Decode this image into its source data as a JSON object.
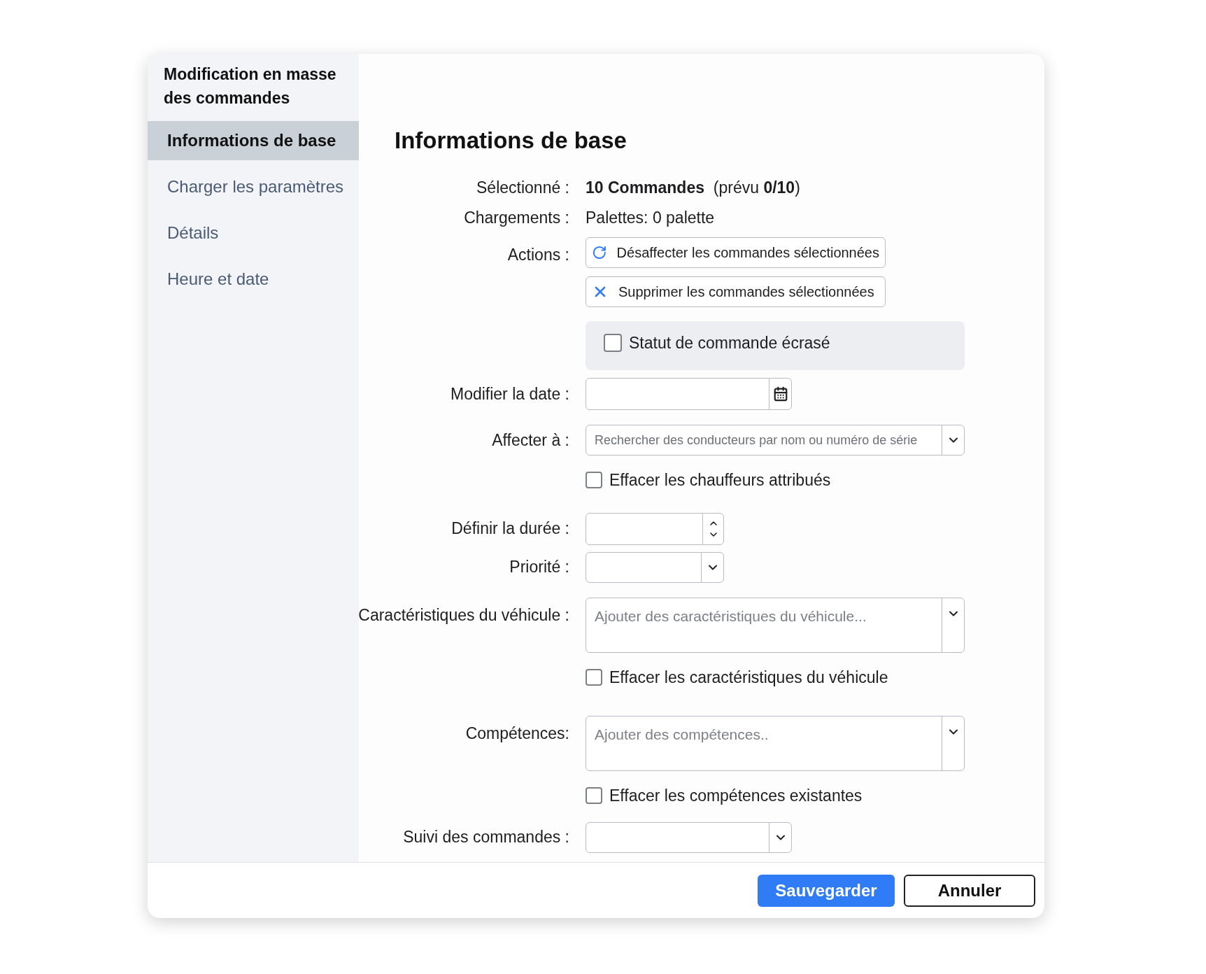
{
  "dialog": {
    "title": "Modification en masse des commandes"
  },
  "sidebar": {
    "items": [
      {
        "label": "Informations de base",
        "selected": true
      },
      {
        "label": "Charger les paramètres",
        "selected": false
      },
      {
        "label": "Détails",
        "selected": false
      },
      {
        "label": "Heure et date",
        "selected": false
      }
    ]
  },
  "section_title": "Informations de base",
  "summary": [
    {
      "label": "Sélectionné :",
      "value": "**10 Commandes**  (prévu **0/10**)"
    },
    {
      "label": "Chargements :",
      "value": "Palettes: 0 palette"
    }
  ],
  "actions": {
    "label": "Actions :",
    "buttons": [
      {
        "kind": "unassign",
        "label": "Désaffecter les commandes sélectionnées"
      },
      {
        "kind": "delete",
        "label": "Supprimer les commandes sélectionnées"
      }
    ]
  },
  "status_override": {
    "label": "Statut de commande écrasé",
    "checked": false
  },
  "fields": [
    {
      "kind": "date",
      "label": "Modifier la date :"
    },
    {
      "kind": "search",
      "label": "Affecter à :",
      "placeholder": "Rechercher des conducteurs par nom ou numéro de série",
      "clear": {
        "label": "Effacer les chauffeurs attribués",
        "checked": false
      }
    },
    {
      "kind": "number",
      "label": "Définir la durée :"
    },
    {
      "kind": "select",
      "label": "Priorité :"
    },
    {
      "kind": "multi",
      "label": "Caractéristiques du véhicule :",
      "placeholder": "Ajouter des caractéristiques du véhicule...",
      "clear": {
        "label": "Effacer les caractéristiques du véhicule",
        "checked": false
      }
    },
    {
      "kind": "multi",
      "label": "Compétences:",
      "placeholder": "Ajouter des compétences..",
      "clear": {
        "label": "Effacer les compétences existantes",
        "checked": false
      }
    },
    {
      "kind": "select",
      "label": "Suivi des commandes :"
    }
  ],
  "footer": {
    "buttons": [
      {
        "kind": "primary",
        "label": "Sauvegarder"
      },
      {
        "kind": "secondary",
        "label": "Annuler"
      }
    ]
  }
}
